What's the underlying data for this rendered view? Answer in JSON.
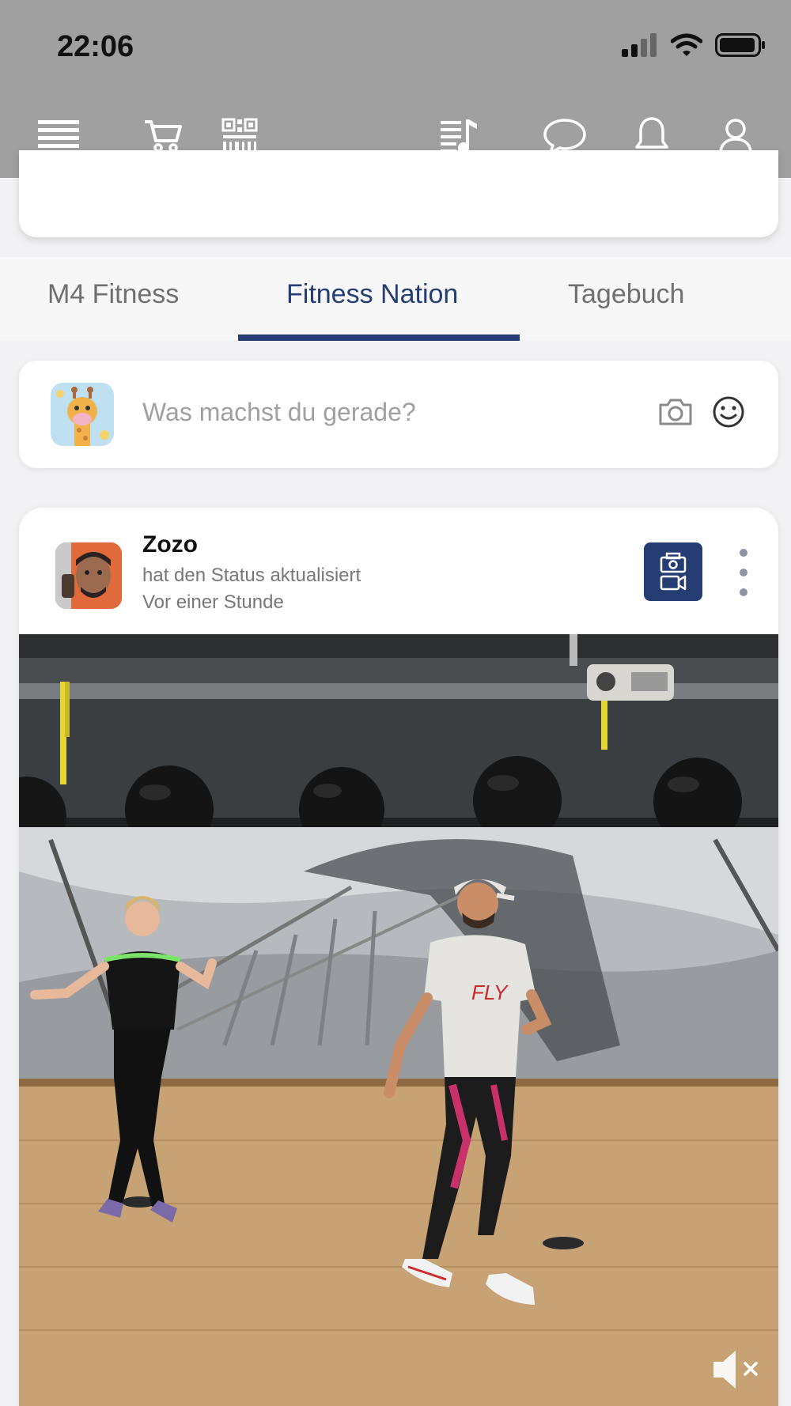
{
  "status_bar": {
    "time": "22:06"
  },
  "header": {
    "icons": [
      "menu-icon",
      "cart-icon",
      "qr-code-icon",
      "playlist-icon",
      "chat-icon",
      "bell-icon",
      "user-icon"
    ]
  },
  "tabs": [
    {
      "label": "M4 Fitness",
      "active": false
    },
    {
      "label": "Fitness Nation",
      "active": true
    },
    {
      "label": "Tagebuch",
      "active": false
    }
  ],
  "composer": {
    "placeholder": "Was machst du gerade?",
    "icons": [
      "camera-icon",
      "smiley-icon"
    ]
  },
  "post": {
    "author": "Zozo",
    "action": "hat den Status aktualisiert",
    "time": "Vor einer Stunde",
    "badge_icon": "photo-video-icon",
    "video": {
      "shirt_text": "FLY",
      "muted": true
    }
  },
  "colors": {
    "accent": "#263d73",
    "header_bg": "#a0a0a0",
    "background": "#f2f2f4"
  }
}
